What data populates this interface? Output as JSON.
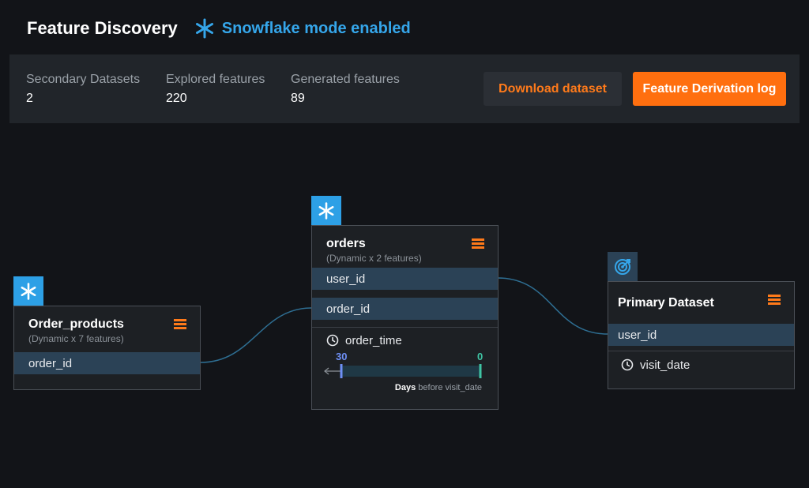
{
  "header": {
    "title": "Feature Discovery",
    "mode_label": "Snowflake mode enabled",
    "mode_icon": "snowflake-icon"
  },
  "stats": [
    {
      "label": "Secondary Datasets",
      "value": "2"
    },
    {
      "label": "Explored features",
      "value": "220"
    },
    {
      "label": "Generated features",
      "value": "89"
    }
  ],
  "buttons": {
    "download": "Download dataset",
    "derivation_log": "Feature Derivation log"
  },
  "order_products": {
    "title": "Order_products",
    "subtitle": "(Dynamic x 7 features)",
    "keys": [
      "order_id"
    ]
  },
  "orders": {
    "title": "orders",
    "subtitle": "(Dynamic x 2 features)",
    "keys": [
      "user_id",
      "order_id"
    ],
    "time_field": "order_time",
    "window_start": "30",
    "window_end": "0",
    "caption_bold": "Days",
    "caption_rest": " before visit_date"
  },
  "primary": {
    "title": "Primary Dataset",
    "keys": [
      "user_id"
    ],
    "time_field": "visit_date"
  },
  "colors": {
    "accent_orange": "#ff6f0f",
    "snowflake_blue": "#2da0e6",
    "key_row": "#2b4256"
  }
}
